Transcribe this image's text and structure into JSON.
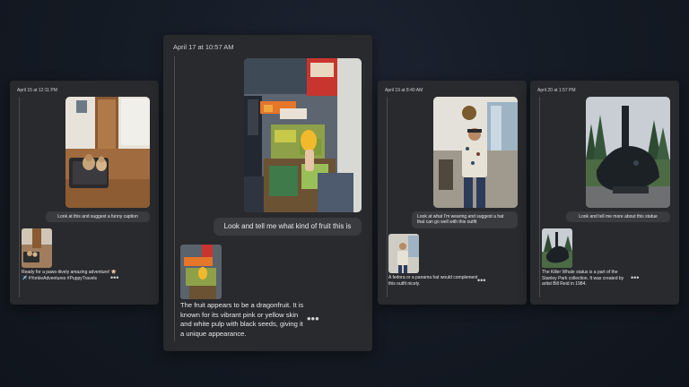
{
  "cards": [
    {
      "timestamp": "April 15 at 12:11 PM",
      "prompt": "Look at this and suggest a funny caption",
      "reply": "Ready for a paws-itively amazing adventure! 🐶✈️ #YorkieAdventures #PuppyTravels",
      "more": "•••",
      "image_subject": "two dogs on a travel bed"
    },
    {
      "timestamp": "April 17 at 10:57 AM",
      "prompt": "Look and tell me what kind of fruit this is",
      "reply": "The fruit appears to be a dragonfruit. It is known for its vibrant pink or yellow skin and white pulp with black seeds, giving it a unique appearance.",
      "more": "•••",
      "image_subject": "hand holding dragonfruit at market stall"
    },
    {
      "timestamp": "April 19 at 8:40 AM",
      "prompt": "Look at what I'm wearing and suggest a hat that can go well with this outfit",
      "reply": "A fedora or a panama hat would complement this outfit nicely.",
      "more": "•••",
      "image_subject": "man in patterned shirt"
    },
    {
      "timestamp": "April 20 at 1:57 PM",
      "prompt": "Look and tell me more about this statue",
      "reply": "The Killer Whale status is a part of the Stanley Park collection. It was created by artist Bill Reid in 1984.",
      "more": "•••",
      "image_subject": "killer whale sculpture"
    }
  ],
  "colors": {
    "background": "#141a23",
    "card": "#292a2d",
    "bubble": "#3a3b3f",
    "text": "#e6e6e6"
  }
}
